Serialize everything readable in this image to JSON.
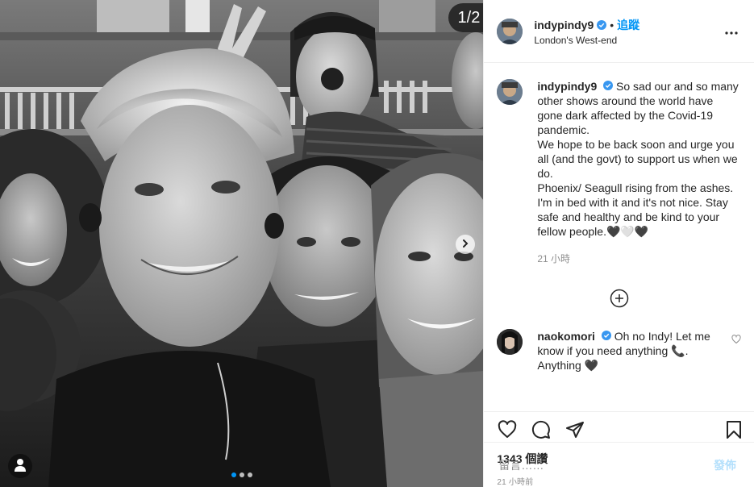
{
  "media": {
    "counter": "1/2",
    "dots": [
      true,
      false,
      false
    ]
  },
  "header": {
    "username": "indypindy9",
    "separator": "•",
    "follow_label": "追蹤",
    "location": "London's West-end"
  },
  "caption": {
    "username": "indypindy9",
    "text": "So sad our and so many other shows around the world have gone dark affected by the Covid-19 pandemic.\nWe hope to be back soon and urge you all (and the govt) to support us when we do.\nPhoenix/ Seagull rising from the ashes. I'm in bed with it and it's not nice. Stay safe and healthy and be kind to your fellow people.🖤🤍🖤",
    "time": "21 小時"
  },
  "comments": [
    {
      "username": "naokomori",
      "text": "Oh no Indy! Let me know if you need anything 📞. Anything 🖤"
    }
  ],
  "stats": {
    "likes": "1343 個讚",
    "time": "21 小時前"
  },
  "add_comment": {
    "placeholder": "留言……",
    "post_label": "發佈"
  },
  "colors": {
    "accent": "#0095f6",
    "post_disabled": "#b2dffc",
    "muted": "#8e8e8e"
  },
  "icons": [
    "verified-badge-icon",
    "more-options-icon",
    "chevron-right-icon",
    "plus-circle-icon",
    "heart-icon",
    "comment-icon",
    "share-icon",
    "bookmark-icon",
    "user-tag-icon"
  ]
}
